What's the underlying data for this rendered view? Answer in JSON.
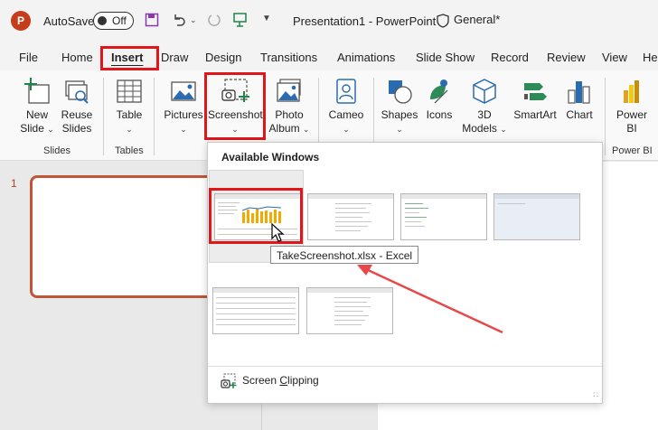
{
  "titlebar": {
    "logo": "P",
    "autosave_label": "AutoSave",
    "autosave_state": "Off",
    "doc_title": "Presentation1  -  PowerPoint",
    "sensitivity": "General*",
    "icons": [
      "save-icon",
      "undo-icon",
      "redo-icon",
      "present-icon",
      "customize-icon"
    ]
  },
  "tabs": [
    "File",
    "Home",
    "Insert",
    "Draw",
    "Design",
    "Transitions",
    "Animations",
    "Slide Show",
    "Record",
    "Review",
    "View",
    "He"
  ],
  "active_tab": "Insert",
  "ribbon": {
    "buttons": {
      "new_slide": [
        "New",
        "Slide"
      ],
      "reuse_slides": [
        "Reuse",
        "Slides"
      ],
      "table": [
        "Table"
      ],
      "pictures": [
        "Pictures"
      ],
      "screenshot": [
        "Screenshot"
      ],
      "photo_album": [
        "Photo",
        "Album"
      ],
      "cameo": [
        "Cameo"
      ],
      "shapes": [
        "Shapes"
      ],
      "icons": [
        "Icons"
      ],
      "models_3d": [
        "3D",
        "Models"
      ],
      "smartart": [
        "SmartArt"
      ],
      "chart": [
        "Chart"
      ],
      "power_bi": [
        "Power",
        "BI"
      ]
    },
    "groups": {
      "slides": "Slides",
      "tables": "Tables",
      "power_bi": "Power BI"
    }
  },
  "slide_panel": {
    "slide_number": "1"
  },
  "dropdown": {
    "title": "Available Windows",
    "tooltip": "TakeScreenshot.xlsx - Excel",
    "clipping_label": "Screen Clipping",
    "clipping_underline_char": "C"
  },
  "colors": {
    "highlight": "#e0161b",
    "powerpoint": "#c43e1c",
    "arrow": "#e8484a"
  }
}
